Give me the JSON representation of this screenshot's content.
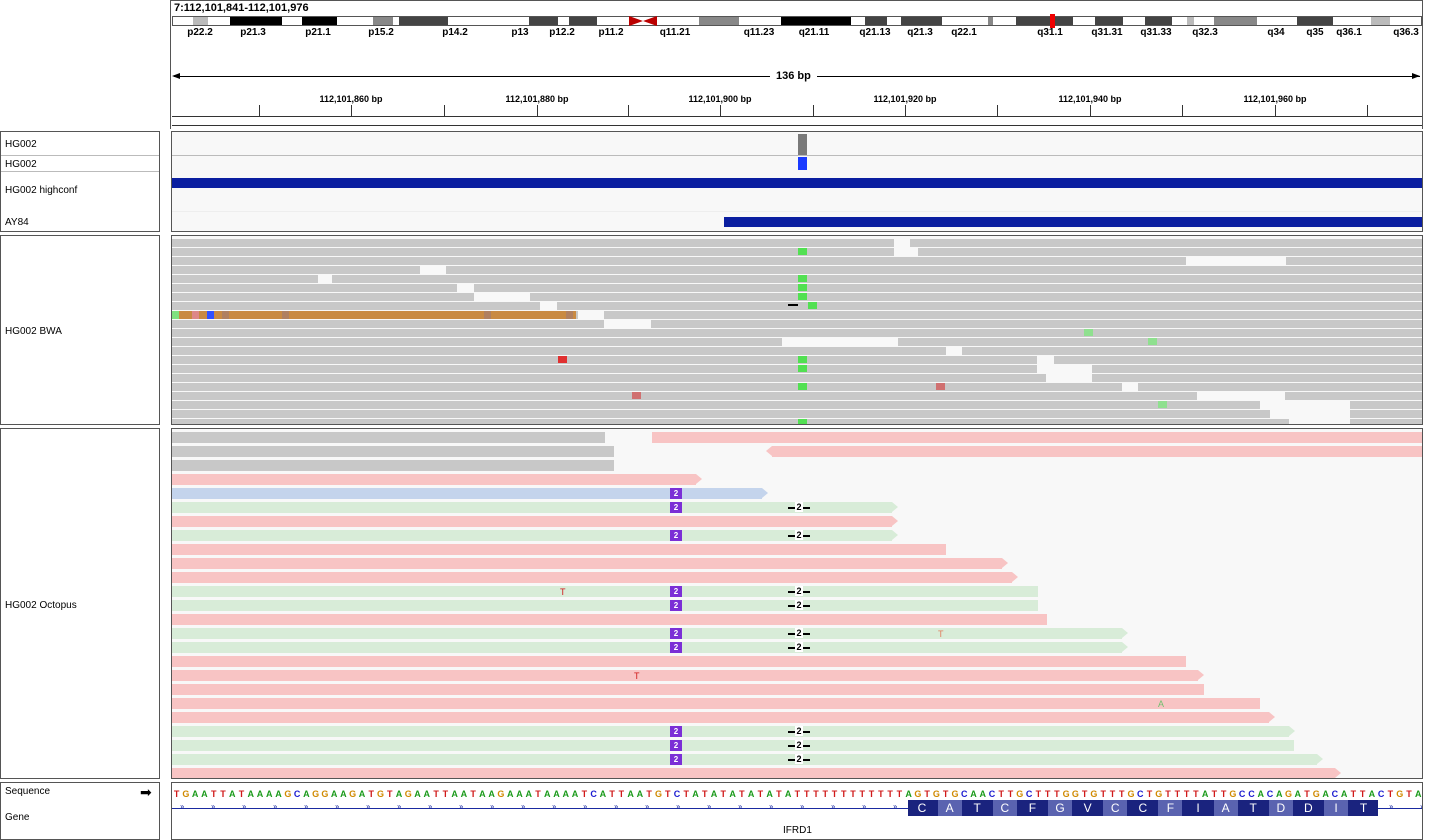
{
  "locus": "7:112,101,841-112,101,976",
  "ideogram_bands": [
    "p22.2",
    "p21.3",
    "p21.1",
    "p15.2",
    "p14.2",
    "p13",
    "p12.2",
    "p11.2",
    "q11.21",
    "q11.23",
    "q21.11",
    "q21.13",
    "q21.3",
    "q22.1",
    "q31.1",
    "q31.31",
    "q31.33",
    "q32.3",
    "q34",
    "q35",
    "q36.1",
    "q36.3"
  ],
  "ruler": {
    "span": "136 bp",
    "ticks": [
      "112,101,860 bp",
      "112,101,880 bp",
      "112,101,900 bp",
      "112,101,920 bp",
      "112,101,940 bp",
      "112,101,960 bp"
    ]
  },
  "tracks": {
    "variant1": "HG002",
    "variant2": "HG002",
    "highconf": "HG002 highconf",
    "ay84": "AY84",
    "bwa": "HG002 BWA",
    "octopus": "HG002 Octopus",
    "sequence": "Sequence",
    "gene": "Gene"
  },
  "sequence": "TGAATTATAAAAGCAGGAAGATGTAGAATTAATAAGAAATAAAATCATTAATGTCTATATATATATATTTTTTTTTTTTAGTGTGCAACTTGCTTTGGTGTTTGCTGTTTTATTGCCACAGATGACATTACTGTAAG",
  "gene_name": "IFRD1",
  "amino_acids": [
    "C",
    "A",
    "T",
    "C",
    "F",
    "G",
    "V",
    "C",
    "C",
    "F",
    "I",
    "A",
    "T",
    "D",
    "D",
    "I",
    "T"
  ],
  "octopus_labels": {
    "insertion": "2",
    "deletion": "2",
    "mm_T": "T",
    "mm_A": "A"
  },
  "colors": {
    "A": "#1a9a1a",
    "C": "#1a1ad0",
    "G": "#d08a00",
    "T": "#d01a1a",
    "bwa_read": "#c8c8c8",
    "red_read": "#f8c4c4",
    "green_read": "#d8ecd8",
    "blue_read": "#c4d4ec",
    "highconf": "#0a1ea0"
  }
}
